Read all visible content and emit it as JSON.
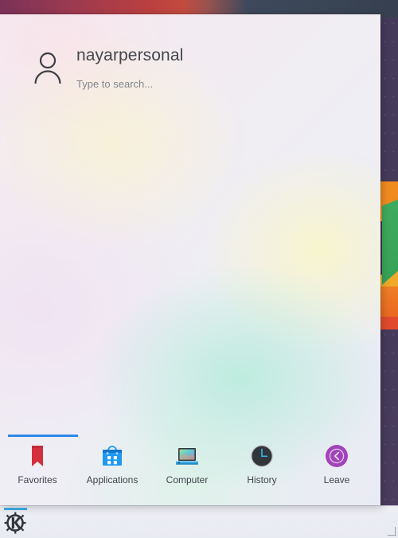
{
  "desktop": {
    "wallpaper_top_band_colors": [
      "#7b3258",
      "#bb4040",
      "#36404f"
    ],
    "wallpaper_base_color": "#453a5a",
    "shape_colors": [
      "#f08b1f",
      "#3fab5e",
      "#f0a92a",
      "#e8631f",
      "#e04b2e"
    ]
  },
  "launcher": {
    "header": {
      "avatar_icon": "user-avatar-icon",
      "user_name": "nayarpersonal",
      "search_placeholder": "Type to search...",
      "search_value": ""
    },
    "active_tab_index": 0,
    "accent_color": "#2f87e8",
    "tabs": [
      {
        "label": "Favorites",
        "icon": "bookmark-icon"
      },
      {
        "label": "Applications",
        "icon": "shopping-bag-icon"
      },
      {
        "label": "Computer",
        "icon": "laptop-icon"
      },
      {
        "label": "History",
        "icon": "clock-icon"
      },
      {
        "label": "Leave",
        "icon": "power-chevron-icon"
      }
    ]
  },
  "taskbar": {
    "launcher_button_icon": "kde-k-logo-icon",
    "launcher_button_active": true,
    "resize_grip_icon": "resize-grip-icon"
  }
}
